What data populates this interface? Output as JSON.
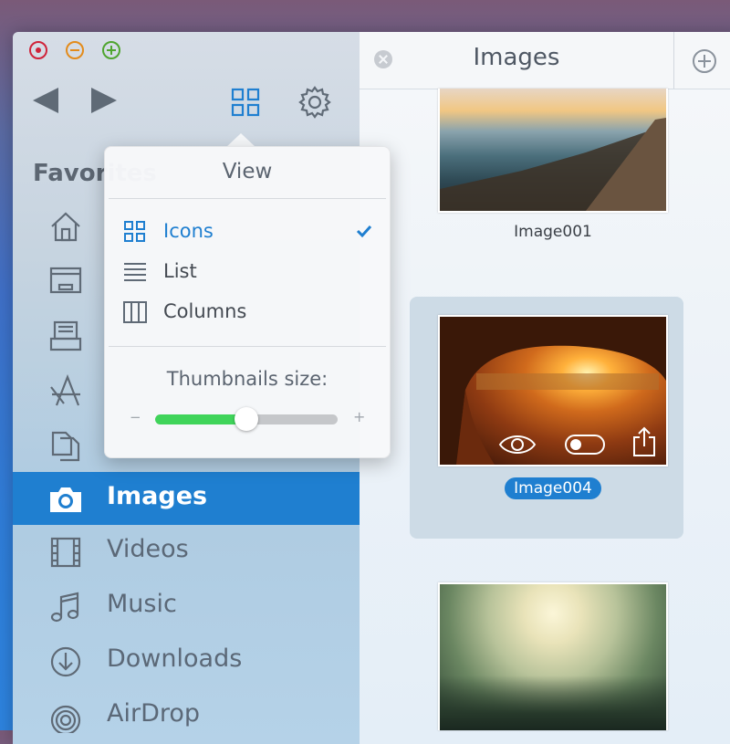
{
  "window": {
    "traffic_lights": [
      "close",
      "minimize",
      "zoom"
    ]
  },
  "toolbar": {
    "back_icon": "triangle-left-icon",
    "forward_icon": "triangle-right-icon",
    "view_icon": "grid-icon",
    "settings_icon": "gear-icon"
  },
  "sidebar": {
    "heading": "Favorites",
    "items": [
      {
        "label": "",
        "icon": "home-icon"
      },
      {
        "label": "",
        "icon": "desktop-icon"
      },
      {
        "label": "",
        "icon": "documents-icon"
      },
      {
        "label": "",
        "icon": "applications-icon"
      },
      {
        "label": "",
        "icon": "files-icon"
      },
      {
        "label": "Images",
        "icon": "camera-icon",
        "active": true
      },
      {
        "label": "Videos",
        "icon": "film-icon"
      },
      {
        "label": "Music",
        "icon": "music-note-icon"
      },
      {
        "label": "Downloads",
        "icon": "download-icon"
      },
      {
        "label": "AirDrop",
        "icon": "airdrop-icon"
      }
    ]
  },
  "content": {
    "tab_title": "Images",
    "images": [
      {
        "name": "Image001",
        "selected": false
      },
      {
        "name": "Image004",
        "selected": true
      },
      {
        "name": "",
        "selected": false
      }
    ],
    "hover_actions": [
      "eye-icon",
      "toggle-icon",
      "share-icon"
    ]
  },
  "view_popover": {
    "title": "View",
    "options": [
      {
        "label": "Icons",
        "icon": "grid-icon",
        "selected": true
      },
      {
        "label": "List",
        "icon": "list-icon",
        "selected": false
      },
      {
        "label": "Columns",
        "icon": "columns-icon",
        "selected": false
      }
    ],
    "thumbnail_label": "Thumbnails size:",
    "slider_min": "−",
    "slider_max": "+",
    "slider_value": 0.5
  },
  "colors": {
    "accent": "#1f7fd0",
    "slider_fill": "#3fd45a",
    "close": "#d0233a",
    "minimize": "#e38b1b",
    "zoom": "#4fa52f"
  }
}
